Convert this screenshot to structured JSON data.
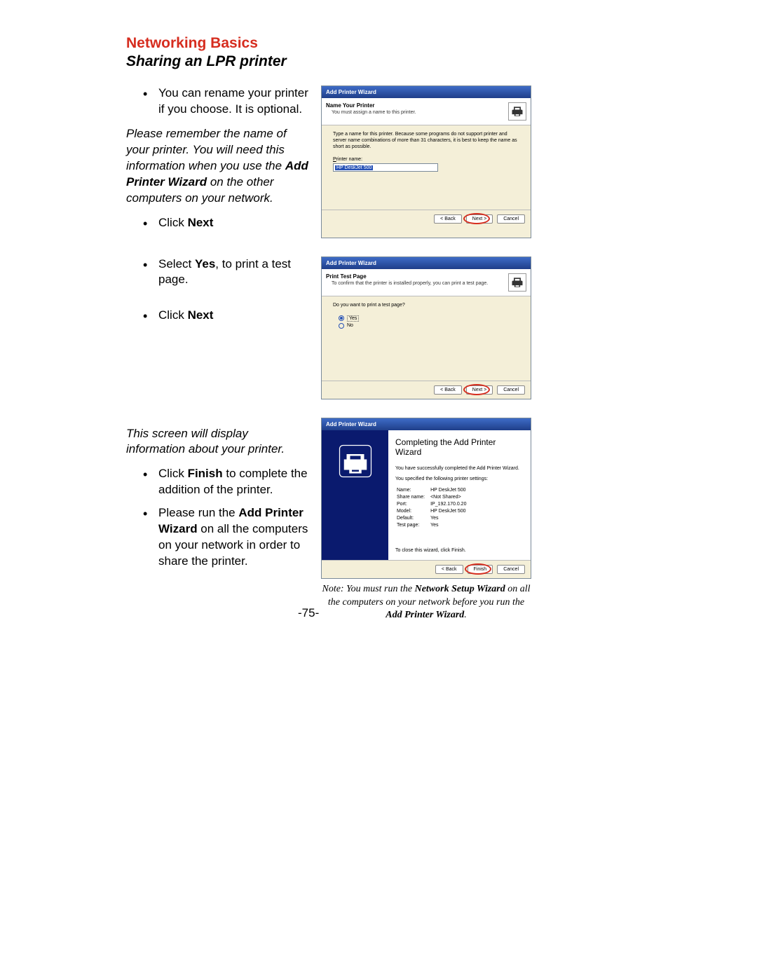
{
  "heading": {
    "title": "Networking Basics",
    "subtitle": "Sharing an LPR printer"
  },
  "left1": {
    "bullet1": "You can rename your printer if you choose. It is optional.",
    "italic1_a": "Please remember the name of your printer.    You will need this information when you use the ",
    "italic1_bold": "Add Printer Wizard",
    "italic1_b": " on the other computers on your network.",
    "bullet2_a": "Click ",
    "bullet2_b": "Next"
  },
  "left2": {
    "bullet1_a": "Select ",
    "bullet1_b": "Yes",
    "bullet1_c": ", to print a test page.",
    "bullet2_a": "Click ",
    "bullet2_b": "Next"
  },
  "left3": {
    "italic1": "This screen will display information about your printer.",
    "bullet1_a": "Click ",
    "bullet1_b": "Finish",
    "bullet1_c": " to complete the addition of the printer.",
    "bullet2_a": "Please run the ",
    "bullet2_b": "Add Printer Wizard",
    "bullet2_c": " on all the computers on your network in order to share the printer."
  },
  "wizard1": {
    "title": "Add Printer Wizard",
    "hdr_title": "Name Your Printer",
    "hdr_sub": "You must assign a name to this printer.",
    "instr": "Type a name for this printer. Because some programs do not support printer and server name combinations of more than 31 characters, it is best to keep the name as short as possible.",
    "field_label": "Printer name:",
    "field_value": "HP DeskJet 500",
    "btn_back": "< Back",
    "btn_next": "Next >",
    "btn_cancel": "Cancel"
  },
  "wizard2": {
    "title": "Add Printer Wizard",
    "hdr_title": "Print Test Page",
    "hdr_sub": "To confirm that the printer is installed properly, you can print a test page.",
    "question": "Do you want to print a test page?",
    "opt_yes": "Yes",
    "opt_no": "No",
    "btn_back": "< Back",
    "btn_next": "Next >",
    "btn_cancel": "Cancel"
  },
  "wizard3": {
    "title": "Add Printer Wizard",
    "big": "Completing the Add Printer Wizard",
    "desc1": "You have successfully completed the Add Printer Wizard.",
    "desc2": "You specified the following printer settings:",
    "rows": {
      "r0k": "Name:",
      "r0v": "HP DeskJet 500",
      "r1k": "Share name:",
      "r1v": "<Not Shared>",
      "r2k": "Port:",
      "r2v": "IP_192.170.0.20",
      "r3k": "Model:",
      "r3v": "HP DeskJet 500",
      "r4k": "Default:",
      "r4v": "Yes",
      "r5k": "Test page:",
      "r5v": "Yes"
    },
    "closemsg": "To close this wizard, click Finish.",
    "btn_back": "< Back",
    "btn_finish": "Finish",
    "btn_cancel": "Cancel"
  },
  "footnote": {
    "a": "Note:    You must run the ",
    "b": "Network Setup Wizard",
    "c": " on all the computers on your network before you run the ",
    "d": "Add Printer Wizard",
    "e": "."
  },
  "pagenum": "-75-"
}
